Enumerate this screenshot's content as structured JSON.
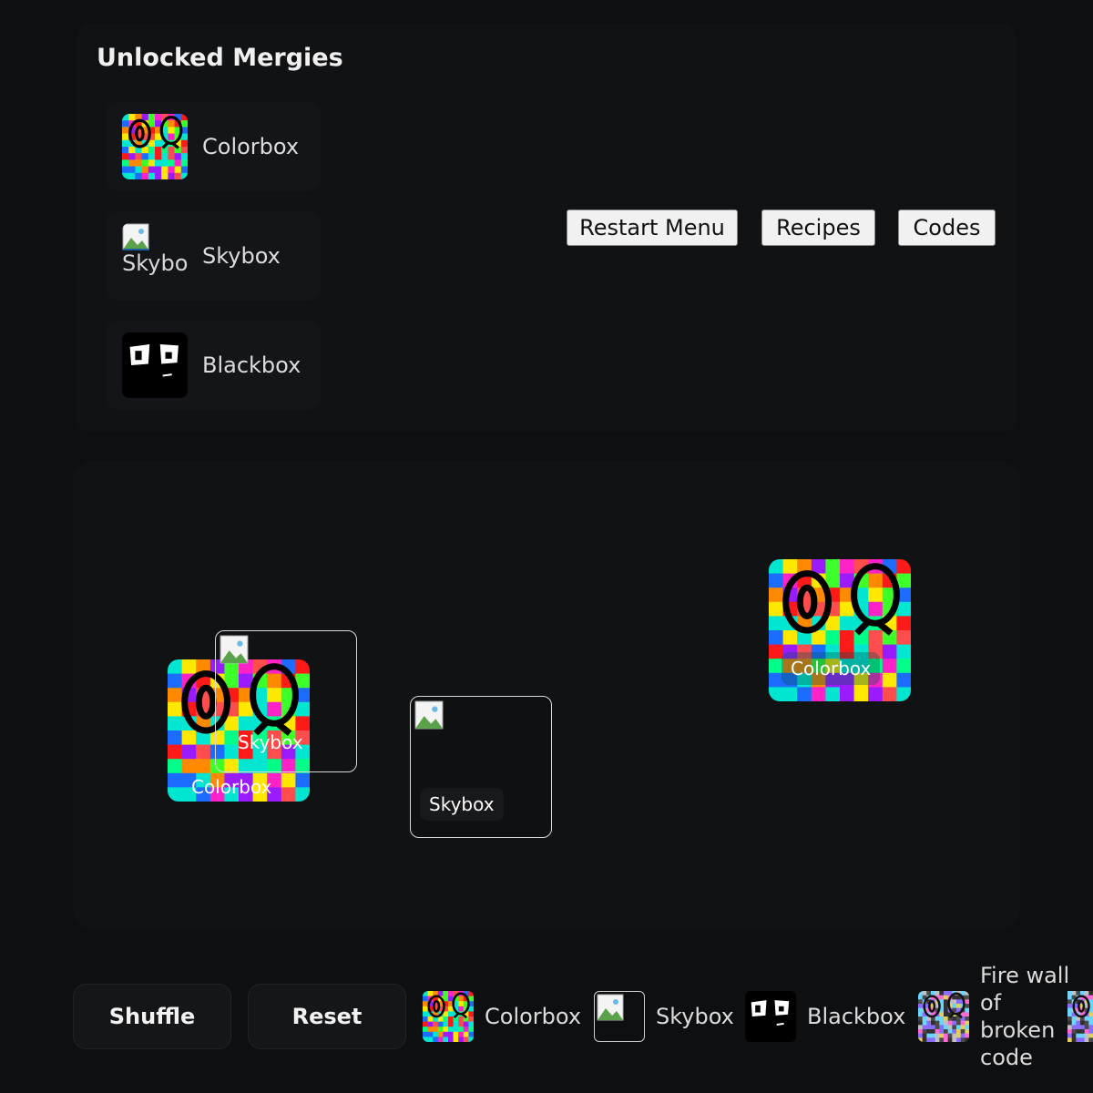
{
  "panel": {
    "title": "Unlocked Mergies"
  },
  "unlocked": [
    {
      "label": "Colorbox",
      "icon": "colorbox-face-icon"
    },
    {
      "label": "Skybox",
      "icon": "broken-image-icon",
      "alt": "Skybox"
    },
    {
      "label": "Blackbox",
      "icon": "blackbox-face-icon"
    }
  ],
  "menu": {
    "restart": "Restart Menu",
    "recipes": "Recipes",
    "codes": "Codes"
  },
  "board": {
    "cards": [
      {
        "label": "Colorbox",
        "type": "colorbox"
      },
      {
        "label": "Skybox",
        "type": "skybox"
      },
      {
        "label": "Skybox",
        "type": "skybox"
      },
      {
        "label": "Colorbox",
        "type": "colorbox"
      }
    ]
  },
  "bottom": {
    "shuffle": "Shuffle",
    "reset": "Reset",
    "tray": [
      {
        "label": "Colorbox",
        "icon": "colorbox-face-icon"
      },
      {
        "label": "Skybox",
        "icon": "broken-image-icon"
      },
      {
        "label": "Blackbox",
        "icon": "blackbox-face-icon"
      },
      {
        "label": "Fire wall of broken code",
        "icon": "firewall-face-icon"
      }
    ]
  },
  "colors": {
    "background": "#0e0f11",
    "panel": "#111214",
    "button": "#f1f1f1"
  }
}
